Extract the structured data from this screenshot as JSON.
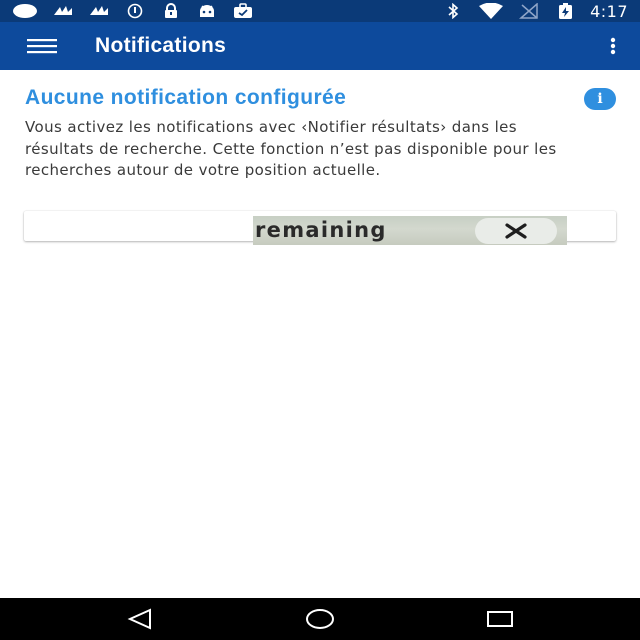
{
  "status_bar": {
    "time": "4:17",
    "icons": [
      "status-dot-icon",
      "signal-app-icon",
      "signal-app-icon",
      "vpn-icon",
      "lock-icon",
      "android-icon",
      "briefcase-icon",
      "bluetooth-icon",
      "wifi-icon",
      "no-signal-icon",
      "battery-charging-icon"
    ]
  },
  "app_bar": {
    "title": "Notifications",
    "menu_icon": "hamburger-menu-icon",
    "overflow_icon": "more-vert-icon"
  },
  "content": {
    "heading": "Aucune notification configurée",
    "info_icon_label": "i",
    "body": "Vous activez les notifications avec ‹Notifier résultats› dans les résultats de recherche. Cette fonction n’est pas disponible pour les recherches autour de votre position actuelle."
  },
  "ad": {
    "text": "remaining",
    "close_icon": "close-icon"
  },
  "nav_bar": {
    "icons": [
      "back-triangle-icon",
      "home-circle-icon",
      "recents-square-icon"
    ]
  },
  "colors": {
    "status_bar": "#0b3a78",
    "app_bar": "#0d4a9c",
    "accent": "#2f8fdf",
    "body_text": "#3a3a3a",
    "nav_bar": "#000000"
  }
}
